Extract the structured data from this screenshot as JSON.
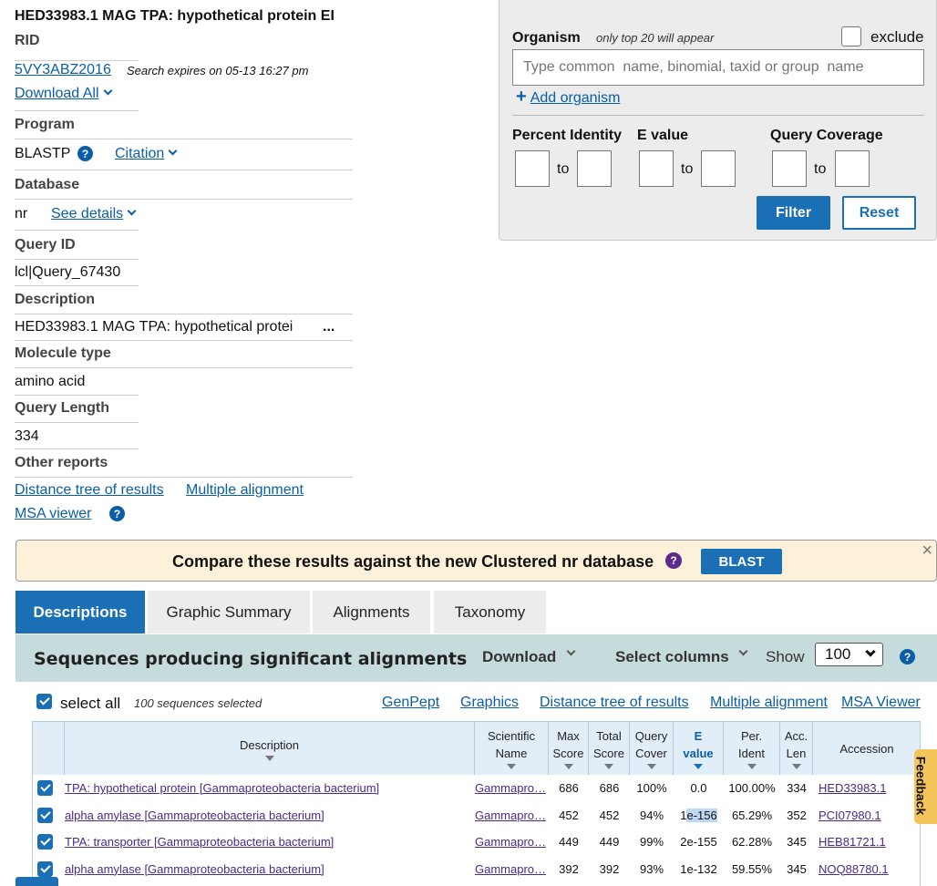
{
  "summary": {
    "title": "HED33983.1 MAG TPA: hypothetical protein EI",
    "rid_label": "RID",
    "rid_value": "5VY3ABZ2016",
    "expires": "Search expires on 05-13 16:27 pm",
    "download_all": "Download All",
    "program_label": "Program",
    "program_value": "BLASTP",
    "citation": "Citation",
    "database_label": "Database",
    "database_value": "nr",
    "see_details": "See details",
    "query_id_label": "Query ID",
    "query_id_value": "lcl|Query_67430",
    "description_label": "Description",
    "description_value": "HED33983.1 MAG TPA: hypothetical protei",
    "description_more": "...",
    "molecule_label": "Molecule type",
    "molecule_value": "amino acid",
    "length_label": "Query Length",
    "length_value": "334",
    "other_label": "Other reports",
    "distance_tree": "Distance tree of results",
    "multiple_alignment": "Multiple alignment",
    "msa_viewer": "MSA viewer"
  },
  "filter": {
    "organism_label": "Organism",
    "organism_note": "only top 20 will appear",
    "exclude_label": "exclude",
    "organism_placeholder": "Type common  name, binomial, taxid or group  name",
    "add_organism": "Add organism",
    "percent_identity": "Percent Identity",
    "evalue": "E value",
    "query_coverage": "Query Coverage",
    "to": "to",
    "filter_btn": "Filter",
    "reset_btn": "Reset"
  },
  "banner": {
    "text": "Compare these results against the new Clustered nr database",
    "button": "BLAST",
    "close": "×"
  },
  "tabs": [
    "Descriptions",
    "Graphic Summary",
    "Alignments",
    "Taxonomy"
  ],
  "results_bar": {
    "title": "Sequences producing significant alignments",
    "download": "Download",
    "select_columns": "Select columns",
    "show_label": "Show",
    "show_value": "100"
  },
  "select_row": {
    "select_all": "select all",
    "count": "100 sequences selected",
    "links": [
      "GenPept",
      "Graphics",
      "Distance tree of results",
      "Multiple alignment",
      "MSA Viewer"
    ]
  },
  "table": {
    "headers": [
      [
        "Description"
      ],
      [
        "Scientific",
        "Name"
      ],
      [
        "Max",
        "Score"
      ],
      [
        "Total",
        "Score"
      ],
      [
        "Query",
        "Cover"
      ],
      [
        "E",
        "value"
      ],
      [
        "Per.",
        "Ident"
      ],
      [
        "Acc.",
        "Len"
      ],
      [
        "Accession"
      ]
    ],
    "rows": [
      {
        "description": "TPA: hypothetical protein [Gammaproteobacteria bacterium]",
        "sci_name": "Gammapro…",
        "max_score": "686",
        "total_score": "686",
        "query_cover": "100%",
        "evalue_a": "0.0",
        "evalue_b": "",
        "per_ident": "100.00%",
        "acc_len": "334",
        "accession": "HED33983.1"
      },
      {
        "description": "alpha amylase [Gammaproteobacteria bacterium]",
        "sci_name": "Gammapro…",
        "max_score": "452",
        "total_score": "452",
        "query_cover": "94%",
        "evalue_a": "1",
        "evalue_b": "e-156",
        "per_ident": "65.29%",
        "acc_len": "352",
        "accession": "PCI07980.1"
      },
      {
        "description": "TPA: transporter [Gammaproteobacteria bacterium]",
        "sci_name": "Gammapro…",
        "max_score": "449",
        "total_score": "449",
        "query_cover": "99%",
        "evalue_a": "2e-155",
        "evalue_b": "",
        "per_ident": "62.28%",
        "acc_len": "345",
        "accession": "HEB81721.1"
      },
      {
        "description": "alpha amylase [Gammaproteobacteria bacterium]",
        "sci_name": "Gammapro…",
        "max_score": "392",
        "total_score": "392",
        "query_cover": "93%",
        "evalue_a": "1e-132",
        "evalue_b": "",
        "per_ident": "59.55%",
        "acc_len": "345",
        "accession": "NOQ88780.1"
      }
    ]
  },
  "feedback": "Feedback",
  "colors": {
    "accent": "#1a6fb5",
    "banner_bg": "#fdf1d9",
    "results_bar_bg": "#c6dbdc",
    "table_header_bg": "#e1eef7",
    "visited_link": "#4a2a8a",
    "feedback_tab": "#f3c55b"
  }
}
